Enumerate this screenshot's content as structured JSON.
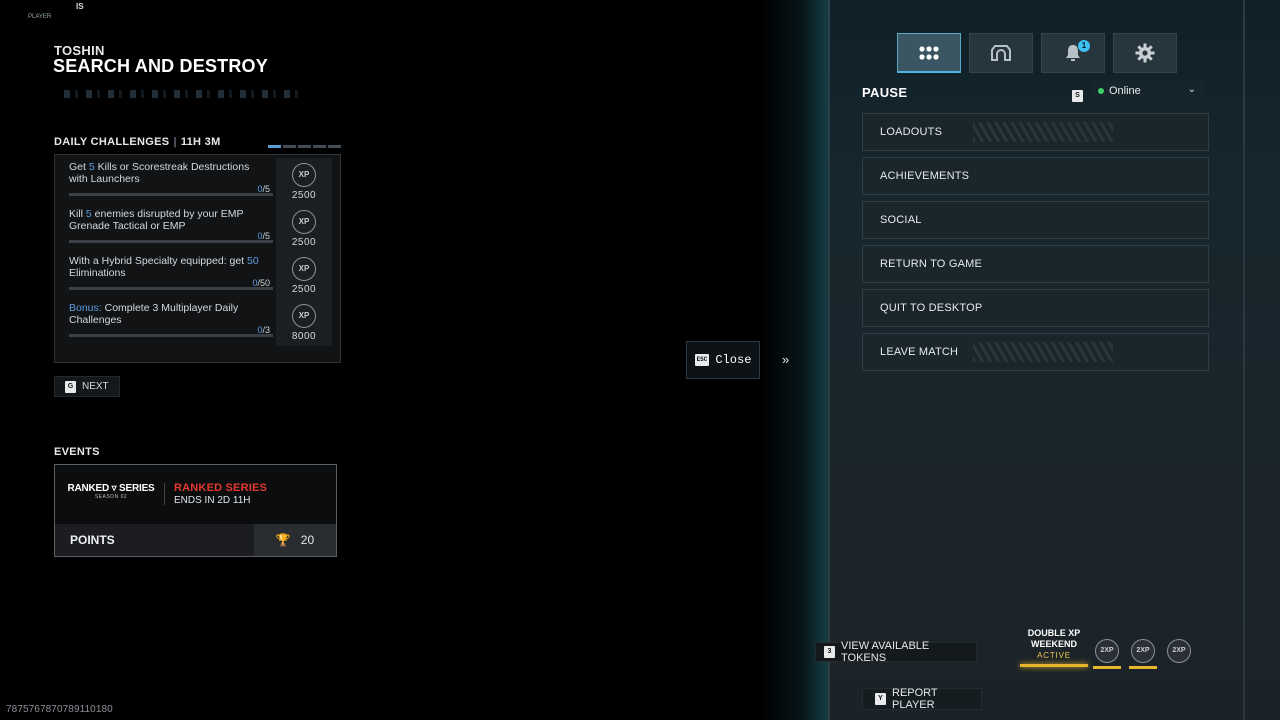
{
  "corner": {
    "top_text": "PLAYER",
    "top_icon": "IS"
  },
  "header": {
    "map": "TOSHIN",
    "mode": "SEARCH AND DESTROY"
  },
  "daily_challenges": {
    "title": "DAILY CHALLENGES",
    "timer": "11H 3M",
    "pages": 5,
    "active_page": 1,
    "items": [
      {
        "pre": "Get ",
        "hl": "5",
        "post": " Kills or Scorestreak Destructions with Launchers",
        "cur": "0",
        "total": "/5",
        "badge": "XP",
        "reward": "2500"
      },
      {
        "pre": "Kill ",
        "hl": "5",
        "post": " enemies disrupted by your EMP Grenade Tactical or EMP",
        "cur": "0",
        "total": "/5",
        "badge": "XP",
        "reward": "2500"
      },
      {
        "pre": "With a Hybrid Specialty equipped: get ",
        "hl": "50",
        "post": " Eliminations",
        "cur": "0",
        "total": "/50",
        "badge": "XP",
        "reward": "2500"
      },
      {
        "pre": "",
        "hl": "Bonus:",
        "post": " Complete 3 Multiplayer Daily Challenges",
        "cur": "0",
        "total": "/3",
        "badge": "XP",
        "reward": "8000"
      }
    ]
  },
  "next_button": {
    "key": "G",
    "label": "NEXT"
  },
  "events": {
    "title": "EVENTS",
    "logo_line1": "RANKED ▿ SERIES",
    "logo_line2": "SEASON 02",
    "name": "RANKED SERIES",
    "ends": "ENDS IN 2D 11H",
    "points_label": "POINTS",
    "points_value": "20"
  },
  "build_id": "7875767870789110180",
  "close_button": {
    "key": "ESC",
    "label": "Close"
  },
  "chevron": "»",
  "tabs": [
    {
      "icon": "grid-icon",
      "glyph": "⠿",
      "active": true
    },
    {
      "icon": "headset-icon",
      "glyph": "⌂",
      "active": false
    },
    {
      "icon": "bell-icon",
      "glyph": "🔔",
      "badge": "1",
      "active": false
    },
    {
      "icon": "gear-icon",
      "glyph": "⚙",
      "active": false
    }
  ],
  "pause": {
    "title": "PAUSE",
    "status_key": "S",
    "status": "Online",
    "items": [
      "LOADOUTS",
      "ACHIEVEMENTS",
      "SOCIAL",
      "RETURN TO GAME",
      "QUIT TO DESKTOP",
      "LEAVE MATCH"
    ]
  },
  "tokens": {
    "key": "3",
    "label": "VIEW AVAILABLE TOKENS"
  },
  "xp_promo": {
    "line1": "DOUBLE XP",
    "line2": "WEEKEND",
    "status": "ACTIVE"
  },
  "token_badges": [
    "2XP",
    "2XP",
    "2XP"
  ],
  "report": {
    "key": "Y",
    "label": "REPORT PLAYER"
  },
  "colors": {
    "accent_blue": "#5b9ee0",
    "ranked_red": "#e23a2e",
    "xp_gold": "#e8b62e",
    "online_green": "#3ed06a"
  }
}
